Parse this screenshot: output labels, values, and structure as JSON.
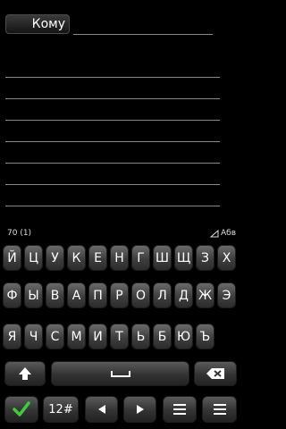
{
  "header": {
    "to_label": "Кому"
  },
  "status": {
    "char_counter": "70 (1)",
    "input_mode": "Абв"
  },
  "keyboard": {
    "row1": [
      "Й",
      "Ц",
      "У",
      "К",
      "Е",
      "Н",
      "Г",
      "Ш",
      "Щ",
      "З",
      "Х"
    ],
    "row2": [
      "Ф",
      "Ы",
      "В",
      "А",
      "П",
      "Р",
      "О",
      "Л",
      "Д",
      "Ж",
      "Э"
    ],
    "row3": [
      "Я",
      "Ч",
      "С",
      "М",
      "И",
      "Т",
      "Ь",
      "Б",
      "Ю",
      "Ъ"
    ],
    "num_label": "12#"
  },
  "colors": {
    "send": "#3ecb3a",
    "key_bg": "#4a4a4a",
    "line": "#8a8a8a"
  }
}
